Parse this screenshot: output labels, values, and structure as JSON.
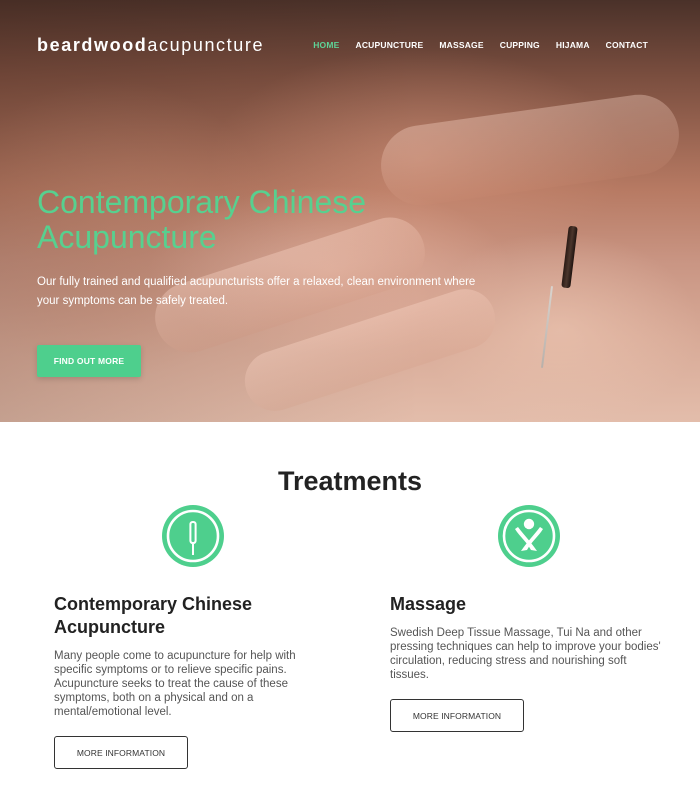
{
  "brand": {
    "bold": "beardwood",
    "light": "acupuncture"
  },
  "nav": {
    "items": [
      {
        "label": "HOME",
        "active": true
      },
      {
        "label": "ACUPUNCTURE"
      },
      {
        "label": "MASSAGE"
      },
      {
        "label": "CUPPING"
      },
      {
        "label": "HIJAMA"
      },
      {
        "label": "CONTACT"
      }
    ]
  },
  "hero": {
    "title": "Contemporary Chinese Acupuncture",
    "subtitle": "Our fully trained and qualified acupuncturists offer a relaxed, clean environment where your symptoms can be safely treated.",
    "button": "FIND OUT MORE"
  },
  "treatments": {
    "title": "Treatments",
    "items": [
      {
        "icon": "acupuncture-needle-icon",
        "heading": "Contemporary Chinese Acupuncture",
        "body": "Many people come to acupuncture for help with specific symptoms or to relieve specific pains. Acupuncture seeks to treat the cause of these symptoms, both on a physical and on a mental/emotional level.",
        "button": "MORE INFORMATION"
      },
      {
        "icon": "massage-figure-icon",
        "heading": "Massage",
        "body": "Swedish Deep Tissue Massage, Tui Na and other pressing techniques can help to improve your bodies' circulation, reducing stress and nourishing soft tissues.",
        "button": "MORE INFORMATION"
      }
    ]
  },
  "colors": {
    "accent": "#4ecf8d",
    "nav_active": "#5ed397",
    "text_dark": "#222222"
  }
}
